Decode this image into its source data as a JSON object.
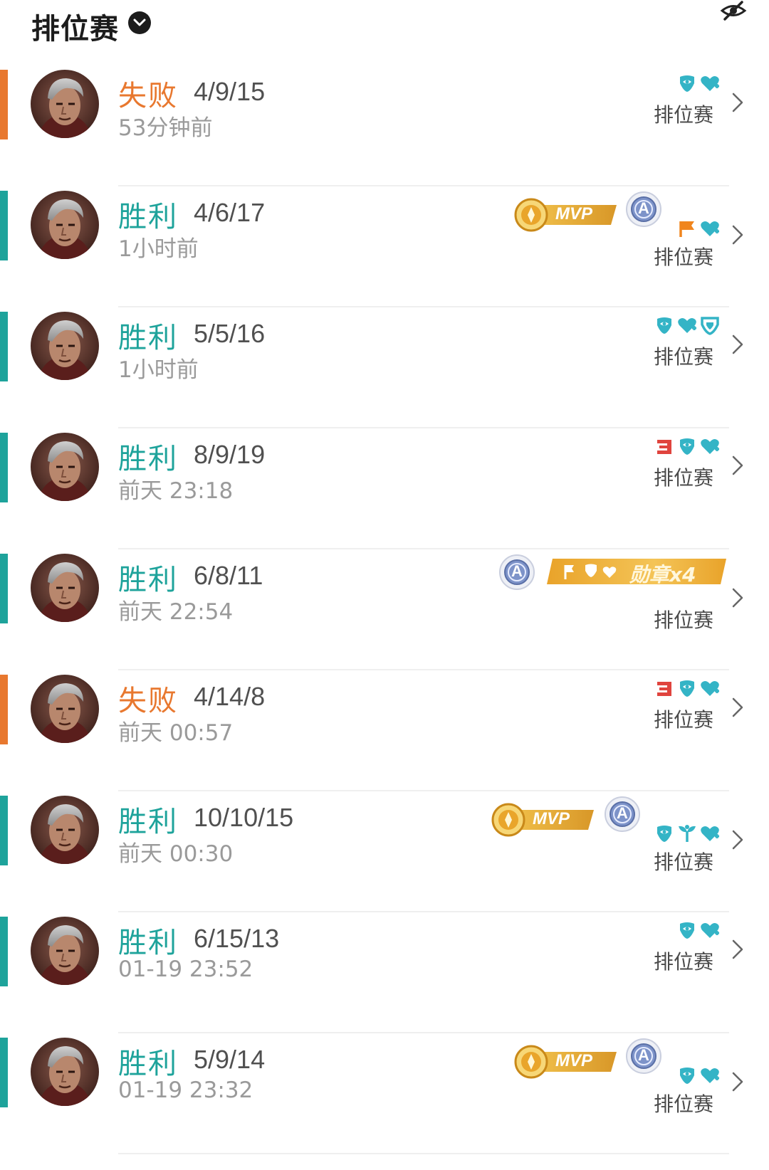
{
  "header": {
    "title": "排位赛"
  },
  "colors": {
    "win": "#1ea39b",
    "lose": "#e8782f",
    "badge_teal": "#34b4c6",
    "mvp_gold": "#e3a62a"
  },
  "matches": [
    {
      "result": "失败",
      "outcome": "lose",
      "kda": "4/9/15",
      "time": "53分钟前",
      "mode": "排位赛",
      "icons": [
        "shield-swirl-icon",
        "heart-plus-icon"
      ],
      "mvp": false,
      "a_badge": false,
      "medal": null
    },
    {
      "result": "胜利",
      "outcome": "win",
      "kda": "4/6/17",
      "time": "1小时前",
      "mode": "排位赛",
      "icons": [
        "flag-icon",
        "heart-plus-icon"
      ],
      "mvp": true,
      "mvp_label": "MVP",
      "a_badge": true,
      "a_label": "A",
      "medal": null
    },
    {
      "result": "胜利",
      "outcome": "win",
      "kda": "5/5/16",
      "time": "1小时前",
      "mode": "排位赛",
      "icons": [
        "shield-swirl-icon",
        "heart-plus-icon",
        "defense-shield-icon"
      ],
      "mvp": false,
      "a_badge": false,
      "medal": null
    },
    {
      "result": "胜利",
      "outcome": "win",
      "kda": "8/9/19",
      "time": "前天 23:18",
      "mode": "排位赛",
      "icons": [
        "triple-kill-icon",
        "shield-swirl-icon",
        "heart-plus-icon"
      ],
      "mvp": false,
      "a_badge": false,
      "medal": null
    },
    {
      "result": "胜利",
      "outcome": "win",
      "kda": "6/8/11",
      "time": "前天 22:54",
      "mode": "排位赛",
      "icons": [],
      "mvp": false,
      "a_badge": true,
      "a_label": "A",
      "medal": "勋章x4"
    },
    {
      "result": "失败",
      "outcome": "lose",
      "kda": "4/14/8",
      "time": "前天 00:57",
      "mode": "排位赛",
      "icons": [
        "triple-kill-icon",
        "shield-swirl-icon",
        "heart-plus-icon"
      ],
      "mvp": false,
      "a_badge": false,
      "medal": null
    },
    {
      "result": "胜利",
      "outcome": "win",
      "kda": "10/10/15",
      "time": "前天 00:30",
      "mode": "排位赛",
      "icons": [
        "shield-swirl-icon",
        "sprout-icon",
        "heart-plus-icon"
      ],
      "mvp": true,
      "mvp_label": "MVP",
      "a_badge": true,
      "a_label": "A",
      "medal": null
    },
    {
      "result": "胜利",
      "outcome": "win",
      "kda": "6/15/13",
      "time": "01-19 23:52",
      "mode": "排位赛",
      "icons": [
        "shield-swirl-icon",
        "heart-plus-icon"
      ],
      "mvp": false,
      "a_badge": false,
      "medal": null
    },
    {
      "result": "胜利",
      "outcome": "win",
      "kda": "5/9/14",
      "time": "01-19 23:32",
      "mode": "排位赛",
      "icons": [
        "shield-swirl-icon",
        "heart-plus-icon"
      ],
      "mvp": true,
      "mvp_label": "MVP",
      "a_badge": true,
      "a_label": "A",
      "medal": null
    }
  ]
}
